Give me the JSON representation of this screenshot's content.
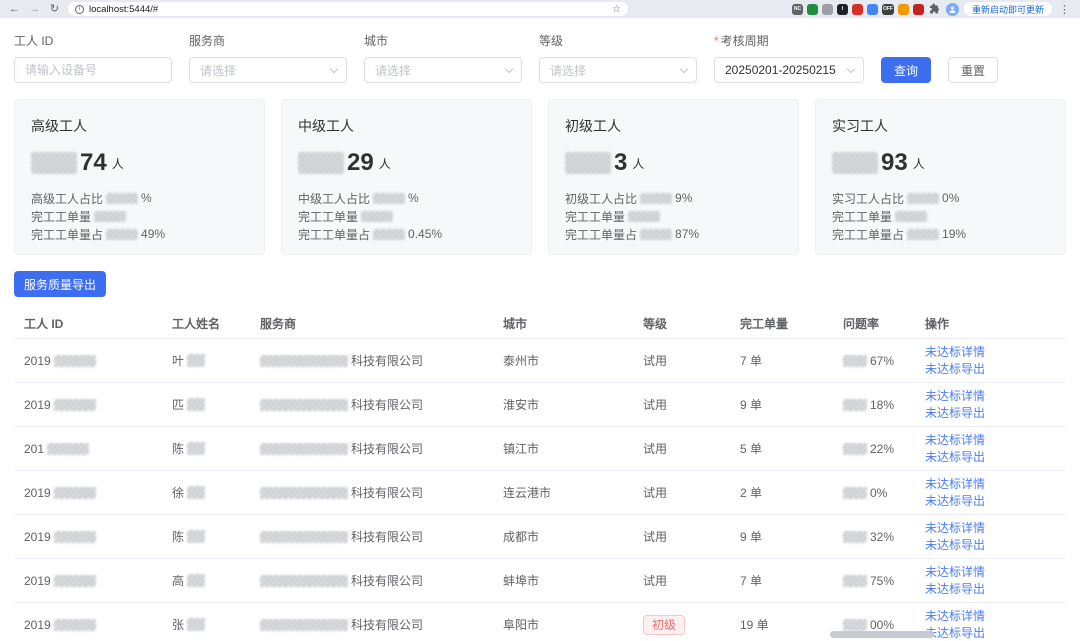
{
  "colors": {
    "accent": "#3d6ef2",
    "danger": "#f56c6c",
    "link": "#4a7df7"
  },
  "browser": {
    "url": "localhost:5444/#",
    "update_button": "重新启动即可更新",
    "extensions": [
      {
        "name": "ext-nc-icon",
        "label": "NC",
        "color": "#5f6368"
      },
      {
        "name": "ext-green-grid-icon",
        "label": "",
        "color": "#1e8e3e"
      },
      {
        "name": "ext-gray-circle-icon",
        "label": "",
        "color": "#9aa0a6"
      },
      {
        "name": "ext-i-icon",
        "label": "I",
        "color": "#202124"
      },
      {
        "name": "ext-red-icon",
        "label": "",
        "color": "#d93025"
      },
      {
        "name": "ext-blue-icon",
        "label": "",
        "color": "#4285f4"
      },
      {
        "name": "ext-off-badge-icon",
        "label": "OFF",
        "color": "#3c4043"
      },
      {
        "name": "ext-orange-icon",
        "label": "",
        "color": "#f29900"
      },
      {
        "name": "ext-crimson-icon",
        "label": "",
        "color": "#c5221f"
      }
    ]
  },
  "filters": {
    "worker_id": {
      "label": "工人 ID",
      "placeholder": "请输入设备号"
    },
    "vendor": {
      "label": "服务商",
      "placeholder": "请选择"
    },
    "city": {
      "label": "城市",
      "placeholder": "请选择"
    },
    "level": {
      "label": "等级",
      "placeholder": "请选择"
    },
    "period": {
      "label": "考核周期",
      "required": "*",
      "value": "20250201-20250215"
    },
    "search_label": "查询",
    "reset_label": "重置"
  },
  "cards": [
    {
      "title": "高级工人",
      "count_visible": "74",
      "count_unit": "人",
      "lines": [
        {
          "prefix": "高级工人占比",
          "suffix": "%"
        },
        {
          "prefix": "完工工单量",
          "suffix": ""
        },
        {
          "prefix": "完工工单量占",
          "suffix": "49%"
        }
      ]
    },
    {
      "title": "中级工人",
      "count_visible": "29",
      "count_unit": "人",
      "lines": [
        {
          "prefix": "中级工人占比",
          "suffix": "%"
        },
        {
          "prefix": "完工工单量",
          "suffix": ""
        },
        {
          "prefix": "完工工单量占",
          "suffix": "0.45%"
        }
      ]
    },
    {
      "title": "初级工人",
      "count_visible": "3",
      "count_unit": "人",
      "lines": [
        {
          "prefix": "初级工人占比",
          "suffix": "9%"
        },
        {
          "prefix": "完工工单量",
          "suffix": ""
        },
        {
          "prefix": "完工工单量占",
          "suffix": "87%"
        }
      ]
    },
    {
      "title": "实习工人",
      "count_visible": "93",
      "count_unit": "人",
      "lines": [
        {
          "prefix": "实习工人占比",
          "suffix": "0%"
        },
        {
          "prefix": "完工工单量",
          "suffix": ""
        },
        {
          "prefix": "完工工单量占",
          "suffix": "19%"
        }
      ]
    }
  ],
  "export_button": "服务质量导出",
  "table": {
    "columns": [
      "工人 ID",
      "工人姓名",
      "服务商",
      "城市",
      "等级",
      "完工单量",
      "问题率",
      "操作"
    ],
    "action_labels": [
      "未达标详情",
      "未达标导出"
    ],
    "rows": [
      {
        "id_prefix": "2019",
        "name": "叶",
        "vendor_suffix": "科技有限公司",
        "city": "泰州市",
        "level": "试用",
        "level_badge": false,
        "orders": "7 单",
        "rate_suffix": "67%"
      },
      {
        "id_prefix": "2019",
        "name": "匹",
        "vendor_suffix": "科技有限公司",
        "city": "淮安市",
        "level": "试用",
        "level_badge": false,
        "orders": "9 单",
        "rate_suffix": "18%"
      },
      {
        "id_prefix": "201",
        "name": "陈",
        "vendor_suffix": "科技有限公司",
        "city": "镇江市",
        "level": "试用",
        "level_badge": false,
        "orders": "5 单",
        "rate_suffix": "22%"
      },
      {
        "id_prefix": "2019",
        "name": "徐",
        "vendor_suffix": "科技有限公司",
        "city": "连云港市",
        "level": "试用",
        "level_badge": false,
        "orders": "2 单",
        "rate_suffix": "0%"
      },
      {
        "id_prefix": "2019",
        "name": "陈",
        "vendor_suffix": "科技有限公司",
        "city": "成都市",
        "level": "试用",
        "level_badge": false,
        "orders": "9 单",
        "rate_suffix": "32%"
      },
      {
        "id_prefix": "2019",
        "name": "高",
        "vendor_suffix": "科技有限公司",
        "city": "蚌埠市",
        "level": "试用",
        "level_badge": false,
        "orders": "7 单",
        "rate_suffix": "75%"
      },
      {
        "id_prefix": "2019",
        "name": "张",
        "vendor_suffix": "科技有限公司",
        "city": "阜阳市",
        "level": "初级",
        "level_badge": true,
        "orders": "19 单",
        "rate_suffix": "00%"
      }
    ]
  }
}
